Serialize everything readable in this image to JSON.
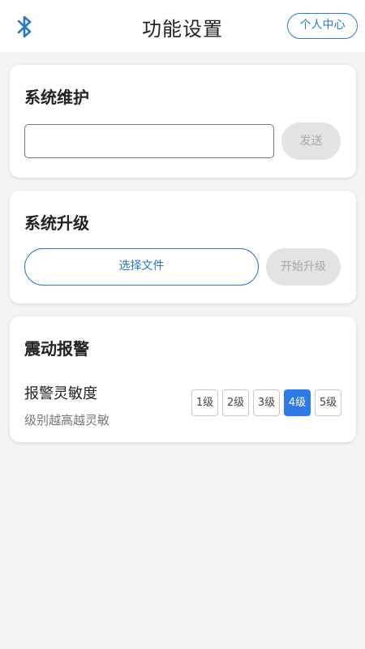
{
  "header": {
    "title": "功能设置",
    "profile_label": "个人中心",
    "bluetooth_icon": "bluetooth-icon"
  },
  "maintenance": {
    "title": "系统维护",
    "input_value": "",
    "send_label": "发送"
  },
  "upgrade": {
    "title": "系统升级",
    "choose_file_label": "选择文件",
    "start_label": "开始升级"
  },
  "alarm": {
    "title": "震动报警",
    "sensitivity_label": "报警灵敏度",
    "sensitivity_hint": "级别越高越灵敏",
    "levels": [
      "1级",
      "2级",
      "3级",
      "4级",
      "5级"
    ],
    "selected_level": "4级"
  },
  "colors": {
    "accent": "#2a78c8",
    "selected": "#2f7be6",
    "disabled_bg": "#e3e3e3",
    "disabled_text": "#a7a7a7"
  }
}
